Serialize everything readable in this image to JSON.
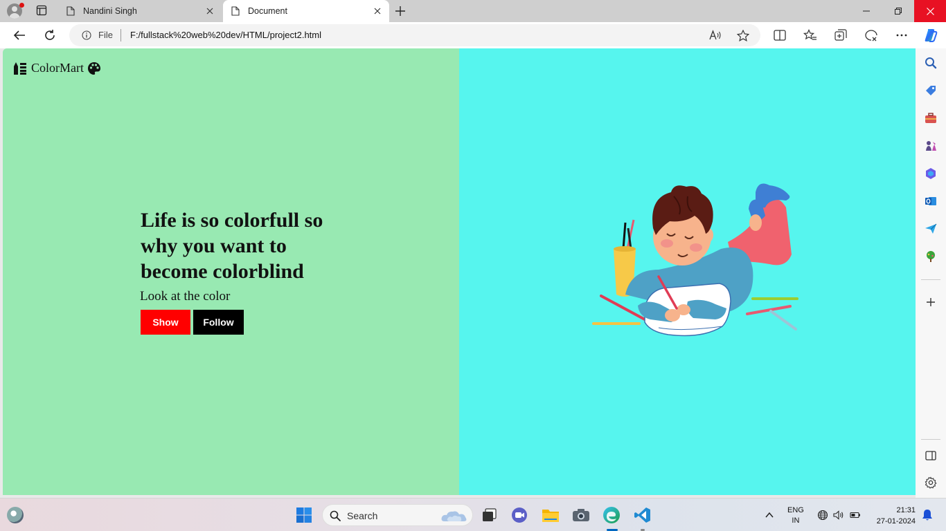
{
  "browser": {
    "tabs": [
      {
        "title": "Nandini Singh",
        "active": false
      },
      {
        "title": "Document",
        "active": true
      }
    ],
    "address": {
      "scheme_label": "File",
      "url": "F:/fullstack%20web%20dev/HTML/project2.html"
    }
  },
  "page": {
    "brand": "ColorMart",
    "hero": {
      "title": "Life is so colorfull so why you want to become colorblind",
      "subtitle": "Look at the color"
    },
    "buttons": {
      "show": "Show",
      "follow": "Follow"
    },
    "colors": {
      "left_bg": "#98e9b2",
      "right_bg": "#56f5ee",
      "show_btn": "#ff0000",
      "follow_btn": "#000000"
    },
    "illustration": "boy-drawing-illustration"
  },
  "taskbar": {
    "search_placeholder": "Search",
    "language": {
      "line1": "ENG",
      "line2": "IN"
    },
    "clock": {
      "time": "21:31",
      "date": "27-01-2024"
    }
  }
}
